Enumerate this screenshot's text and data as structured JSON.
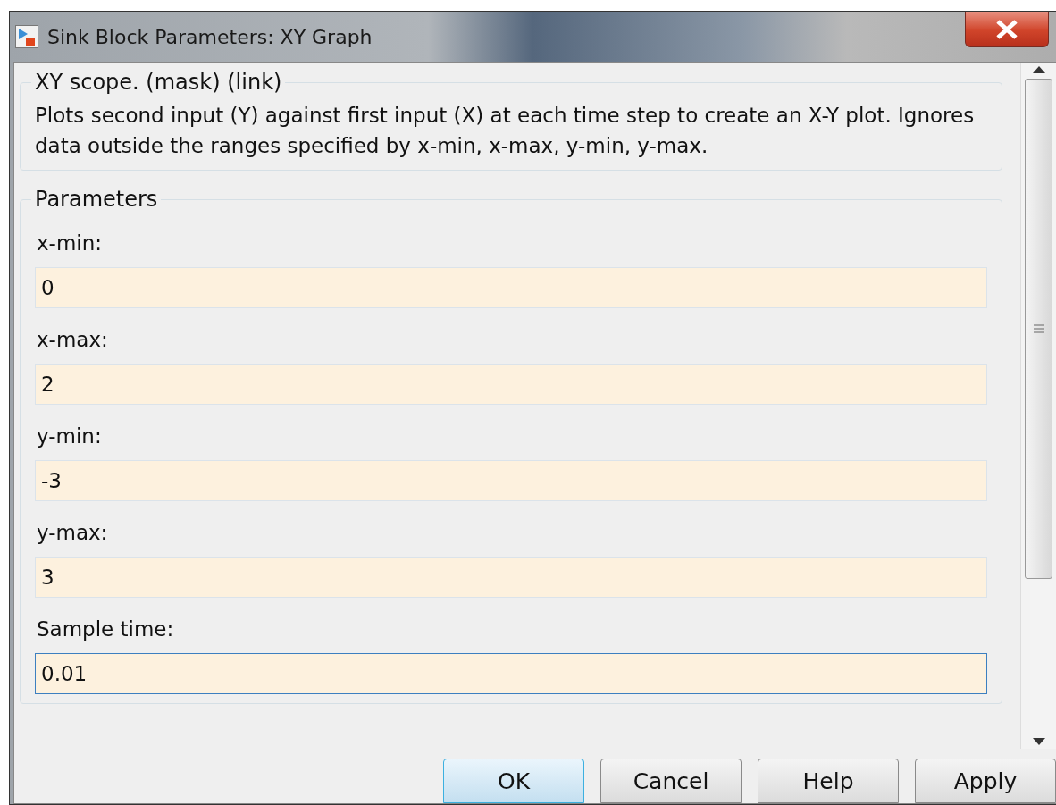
{
  "window": {
    "title": "Sink Block Parameters: XY Graph"
  },
  "description": {
    "title": "XY scope. (mask) (link)",
    "text": "Plots second input (Y) against first input (X) at each time step to  create an X-Y plot. Ignores data outside the ranges specified by x-min, x-max, y-min, y-max."
  },
  "parameters": {
    "title": "Parameters",
    "fields": [
      {
        "label": "x-min:",
        "value": "0",
        "focused": false
      },
      {
        "label": "x-max:",
        "value": "2",
        "focused": false
      },
      {
        "label": "y-min:",
        "value": "-3",
        "focused": false
      },
      {
        "label": "y-max:",
        "value": "3",
        "focused": false
      },
      {
        "label": "Sample time:",
        "value": "0.01",
        "focused": true
      }
    ]
  },
  "buttons": [
    {
      "label": "OK",
      "default": true
    },
    {
      "label": "Cancel",
      "default": false
    },
    {
      "label": "Help",
      "default": false
    },
    {
      "label": "Apply",
      "default": false
    }
  ]
}
